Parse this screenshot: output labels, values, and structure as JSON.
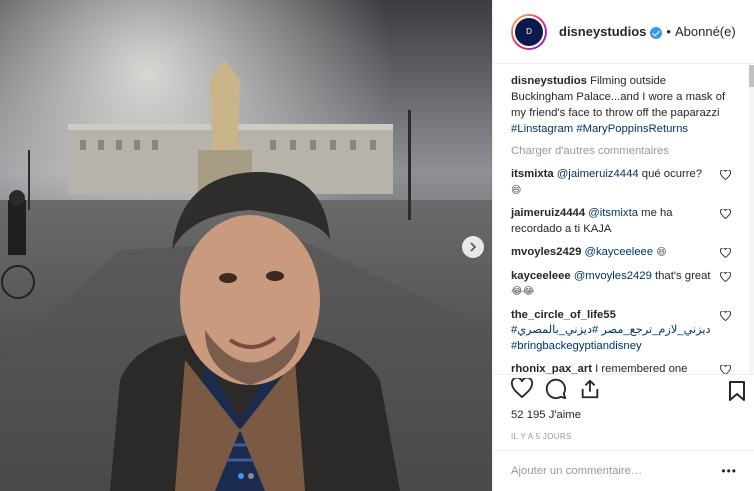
{
  "post": {
    "username": "disneystudios",
    "separator": "•",
    "follow_status": "Abonné(e)",
    "avatar_text": "D",
    "caption_user": "disneystudios",
    "caption_text": "Filming outside Buckingham Palace...and I wore a mask of my friend's face to throw off the paparazzi",
    "caption_tags": [
      "#Linstagram",
      "#MaryPoppinsReturns"
    ],
    "load_more": "Charger d'autres commentaires",
    "likes": "52 195 J'aime",
    "timestamp": "IL Y A 5 JOURS",
    "comment_placeholder": "Ajouter un commentaire…",
    "more": "•••"
  },
  "comments": [
    {
      "user": "itsmixta",
      "mention": "@jaimeruiz4444",
      "text": "qué ocurre?",
      "emoji": "😄"
    },
    {
      "user": "jaimeruiz4444",
      "mention": "@itsmixta",
      "text": "me ha recordado a ti KAJA",
      "emoji": ""
    },
    {
      "user": "mvoyles2429",
      "mention": "@kayceeleee",
      "text": "",
      "emoji": "😄"
    },
    {
      "user": "kayceeleee",
      "mention": "@mvoyles2429",
      "text": "that's great",
      "emoji": "😂😂"
    },
    {
      "user": "the_circle_of_life55",
      "mention": "",
      "text": "#ديزني_لازم_ترجع_مصر #ديزني_بالمصري",
      "emoji": "",
      "tag2": "#bringbackegyptiandisney"
    },
    {
      "user": "rhonix_pax_art",
      "mention": "",
      "text": "I remembered one episode of Sherlock. Do u know which one? :)",
      "emoji": ""
    }
  ],
  "icons": {
    "heart": "heart-icon",
    "comment": "comment-icon",
    "share": "share-icon",
    "bookmark": "bookmark-icon",
    "next": "chevron-right-icon"
  },
  "colors": {
    "link": "#003569",
    "muted": "#999999",
    "accent": "#3897f0"
  }
}
